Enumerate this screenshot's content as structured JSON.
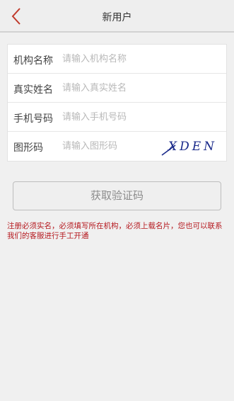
{
  "header": {
    "title": "新用户",
    "back_icon": "chevron-left-icon",
    "accent_color": "#c0392b"
  },
  "form": {
    "fields": [
      {
        "label": "机构名称",
        "placeholder": "请输入机构名称"
      },
      {
        "label": "真实姓名",
        "placeholder": "请输入真实姓名"
      },
      {
        "label": "手机号码",
        "placeholder": "请输入手机号码"
      },
      {
        "label": "图形码",
        "placeholder": "请输入图形码"
      }
    ],
    "captcha_text": "XDEN"
  },
  "actions": {
    "get_code_label": "获取验证码"
  },
  "notice": {
    "text": "注册必须实名，必须填写所在机构，必须上载名片，您也可以联系我们的客服进行手工开通",
    "color": "#b5181e"
  }
}
